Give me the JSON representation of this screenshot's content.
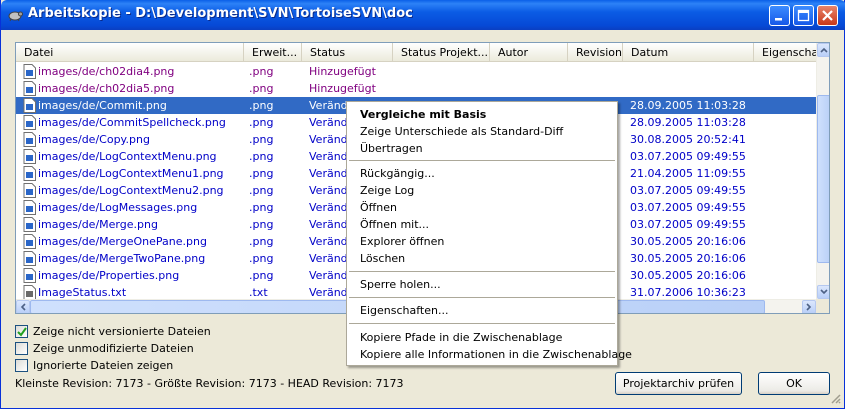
{
  "window": {
    "title": "Arbeitskopie - D:\\Development\\SVN\\TortoiseSVN\\doc"
  },
  "columns": [
    "Datei",
    "Erweit...",
    "Status",
    "Status Projekt...",
    "Autor",
    "Revision",
    "Datum",
    "Eigenschaf"
  ],
  "rows": [
    {
      "path": "images/de/ch02dia4.png",
      "ext": ".png",
      "status": "Hinzugefügt",
      "date": "",
      "kind": "added",
      "selected": false
    },
    {
      "path": "images/de/ch02dia5.png",
      "ext": ".png",
      "status": "Hinzugefügt",
      "date": "",
      "kind": "added",
      "selected": false
    },
    {
      "path": "images/de/Commit.png",
      "ext": ".png",
      "status": "Veränd",
      "date": "28.09.2005 11:03:28",
      "kind": "modified",
      "selected": true
    },
    {
      "path": "images/de/CommitSpellcheck.png",
      "ext": ".png",
      "status": "Veränd",
      "date": "28.09.2005 11:03:28",
      "kind": "modified",
      "selected": false
    },
    {
      "path": "images/de/Copy.png",
      "ext": ".png",
      "status": "Veränd",
      "date": "30.08.2005 20:52:41",
      "kind": "modified",
      "selected": false
    },
    {
      "path": "images/de/LogContextMenu.png",
      "ext": ".png",
      "status": "Veränd",
      "date": "03.07.2005 09:49:55",
      "kind": "modified",
      "selected": false
    },
    {
      "path": "images/de/LogContextMenu1.png",
      "ext": ".png",
      "status": "Veränd",
      "date": "21.04.2005 11:09:55",
      "kind": "modified",
      "selected": false
    },
    {
      "path": "images/de/LogContextMenu2.png",
      "ext": ".png",
      "status": "Veränd",
      "date": "03.07.2005 09:49:55",
      "kind": "modified",
      "selected": false
    },
    {
      "path": "images/de/LogMessages.png",
      "ext": ".png",
      "status": "Veränd",
      "date": "03.07.2005 09:49:55",
      "kind": "modified",
      "selected": false
    },
    {
      "path": "images/de/Merge.png",
      "ext": ".png",
      "status": "Veränd",
      "date": "03.07.2005 09:49:55",
      "kind": "modified",
      "selected": false
    },
    {
      "path": "images/de/MergeOnePane.png",
      "ext": ".png",
      "status": "Veränd",
      "date": "30.05.2005 20:16:06",
      "kind": "modified",
      "selected": false
    },
    {
      "path": "images/de/MergeTwoPane.png",
      "ext": ".png",
      "status": "Veränd",
      "date": "30.05.2005 20:16:06",
      "kind": "modified",
      "selected": false
    },
    {
      "path": "images/de/Properties.png",
      "ext": ".png",
      "status": "Veränd",
      "date": "30.05.2005 20:16:06",
      "kind": "modified",
      "selected": false
    },
    {
      "path": "ImageStatus.txt",
      "ext": ".txt",
      "status": "Veränd",
      "date": "31.07.2006 10:36:23",
      "kind": "modified",
      "selected": false
    }
  ],
  "options": {
    "show_unversioned": {
      "label": "Zeige nicht versionierte Dateien",
      "checked": true
    },
    "show_unmodified": {
      "label": "Zeige unmodifizierte Dateien",
      "checked": false
    },
    "show_ignored": {
      "label": "Ignorierte Dateien zeigen",
      "checked": false
    }
  },
  "status_line": "Kleinste Revision: 7173 - Größte Revision: 7173 - HEAD Revision: 7173",
  "buttons": {
    "check_repository": "Projektarchiv prüfen",
    "ok": "OK"
  },
  "context_menu": {
    "compare_base": "Vergleiche mit Basis",
    "show_diff": "Zeige Unterschiede als Standard-Diff",
    "commit": "Übertragen",
    "revert": "Rückgängig...",
    "show_log": "Zeige Log",
    "open": "Öffnen",
    "open_with": "Öffnen mit...",
    "explorer_open": "Explorer öffnen",
    "delete": "Löschen",
    "get_lock": "Sperre holen...",
    "properties": "Eigenschaften...",
    "copy_paths": "Kopiere Pfade in die Zwischenablage",
    "copy_all": "Kopiere alle Informationen in die Zwischenablage"
  },
  "colors": {
    "added": "#800080",
    "modified": "#0000c8",
    "selection": "#316ac5",
    "titlebar": "#0b5ce5"
  }
}
